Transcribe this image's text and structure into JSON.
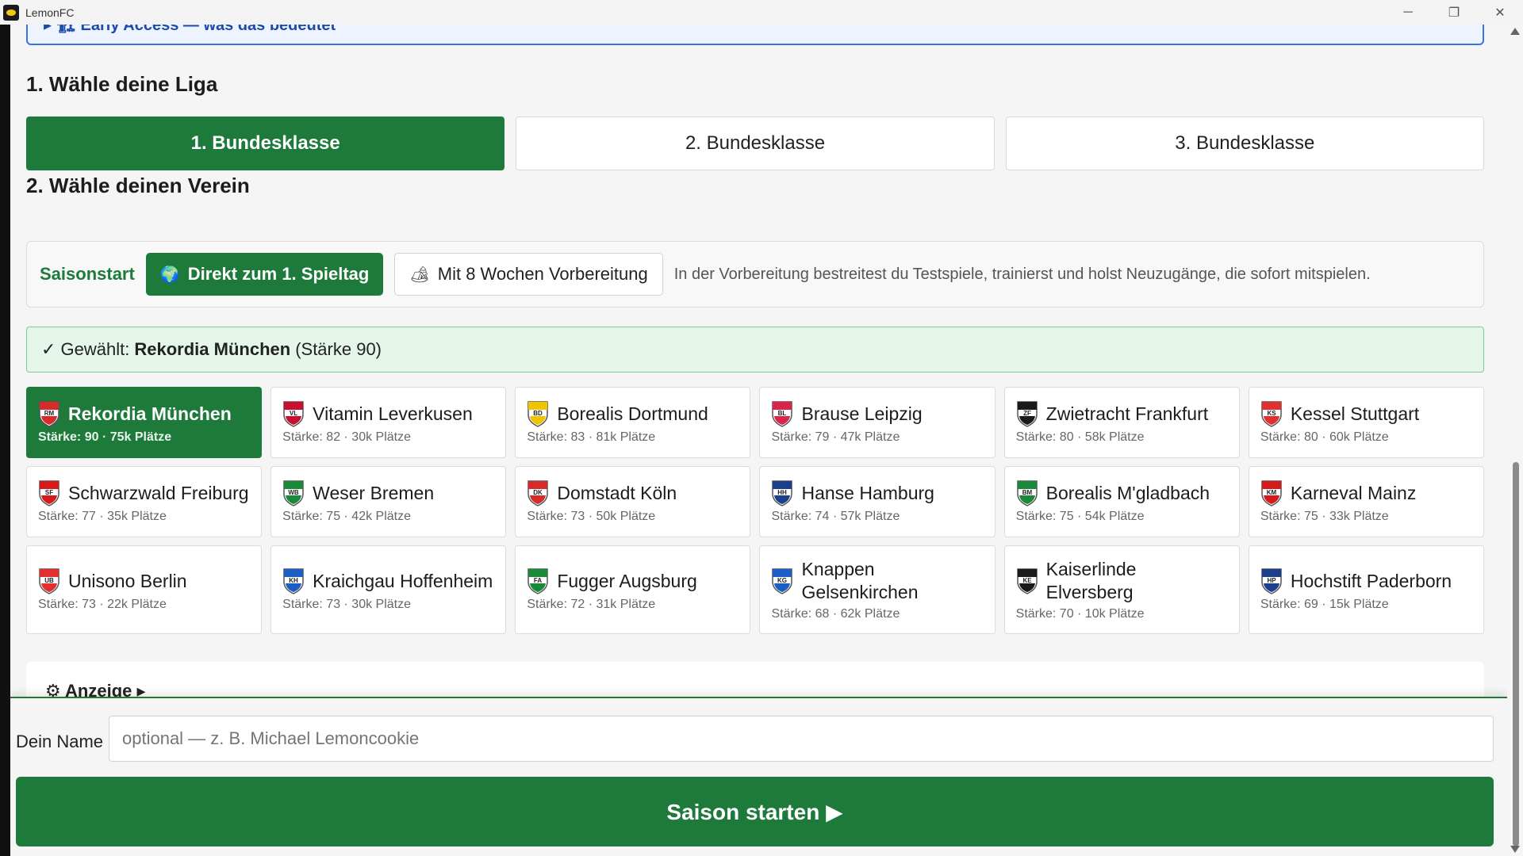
{
  "window": {
    "title": "LemonFC"
  },
  "banner": {
    "text": "▸ 🏗 Early Access — was das bedeutet"
  },
  "league": {
    "heading": "1. Wähle deine Liga",
    "options": [
      "1. Bundesklasse",
      "2. Bundesklasse",
      "3. Bundesklasse"
    ],
    "selected": "1. Bundesklasse"
  },
  "club": {
    "heading": "2. Wähle deinen Verein",
    "season_label": "Saisonstart",
    "option_direct": "Direkt zum 1. Spieltag",
    "option_prep": "Mit 8 Wochen Vorbereitung",
    "hint": "In der Vorbereitung bestreitest du Testspiele, trainierst und holst Neuzugänge, die sofort mitspielen.",
    "selected_prefix": "✓ Gewählt:",
    "selected_name": "Rekordia München",
    "selected_suffix": "(Stärke 90)"
  },
  "clubs": [
    {
      "name": "Rekordia München",
      "sub": "Stärke: 90 · 75k Plätze",
      "abbr": "RM",
      "color": "#d62b2b"
    },
    {
      "name": "Vitamin Leverkusen",
      "sub": "Stärke: 82 · 30k Plätze",
      "abbr": "VL",
      "color": "#c8102e"
    },
    {
      "name": "Borealis Dortmund",
      "sub": "Stärke: 83 · 81k Plätze",
      "abbr": "BD",
      "color": "#f0c400"
    },
    {
      "name": "Brause Leipzig",
      "sub": "Stärke: 79 · 47k Plätze",
      "abbr": "BL",
      "color": "#d9254a"
    },
    {
      "name": "Zwietracht Frankfurt",
      "sub": "Stärke: 80 · 58k Plätze",
      "abbr": "ZF",
      "color": "#1a1a1a"
    },
    {
      "name": "Kessel Stuttgart",
      "sub": "Stärke: 80 · 60k Plätze",
      "abbr": "KS",
      "color": "#e23030"
    },
    {
      "name": "Schwarzwald Freiburg",
      "sub": "Stärke: 77 · 35k Plätze",
      "abbr": "SF",
      "color": "#d61a1a"
    },
    {
      "name": "Weser Bremen",
      "sub": "Stärke: 75 · 42k Plätze",
      "abbr": "WB",
      "color": "#1a8a3a"
    },
    {
      "name": "Domstadt Köln",
      "sub": "Stärke: 73 · 50k Plätze",
      "abbr": "DK",
      "color": "#d62b2b"
    },
    {
      "name": "Hanse Hamburg",
      "sub": "Stärke: 74 · 57k Plätze",
      "abbr": "HH",
      "color": "#1b3f8a"
    },
    {
      "name": "Borealis M'gladbach",
      "sub": "Stärke: 75 · 54k Plätze",
      "abbr": "BM",
      "color": "#1a8a3a"
    },
    {
      "name": "Karneval Mainz",
      "sub": "Stärke: 75 · 33k Plätze",
      "abbr": "KM",
      "color": "#d61a1a"
    },
    {
      "name": "Unisono Berlin",
      "sub": "Stärke: 73 · 22k Plätze",
      "abbr": "UB",
      "color": "#e23030"
    },
    {
      "name": "Kraichgau Hoffenheim",
      "sub": "Stärke: 73 · 30k Plätze",
      "abbr": "KH",
      "color": "#1b5fc4"
    },
    {
      "name": "Fugger Augsburg",
      "sub": "Stärke: 72 · 31k Plätze",
      "abbr": "FA",
      "color": "#1a8a3a"
    },
    {
      "name": "Knappen Gelsenkirchen",
      "sub": "Stärke: 68 · 62k Plätze",
      "abbr": "KG",
      "color": "#1b5fc4"
    },
    {
      "name": "Kaiserlinde Elversberg",
      "sub": "Stärke: 70 · 10k Plätze",
      "abbr": "KE",
      "color": "#1a1a1a"
    },
    {
      "name": "Hochstift Paderborn",
      "sub": "Stärke: 69 · 15k Plätze",
      "abbr": "HP",
      "color": "#1b3f8a"
    }
  ],
  "display_section": {
    "label": "⚙ Anzeige ▸"
  },
  "player": {
    "name_label": "Dein Name",
    "name_placeholder": "optional — z. B. Michael Lemoncookie",
    "name_value": "",
    "start_label": "Saison starten ▶"
  },
  "colors": {
    "accent": "#1d7a3a",
    "accent_light": "#e4f6ea"
  }
}
